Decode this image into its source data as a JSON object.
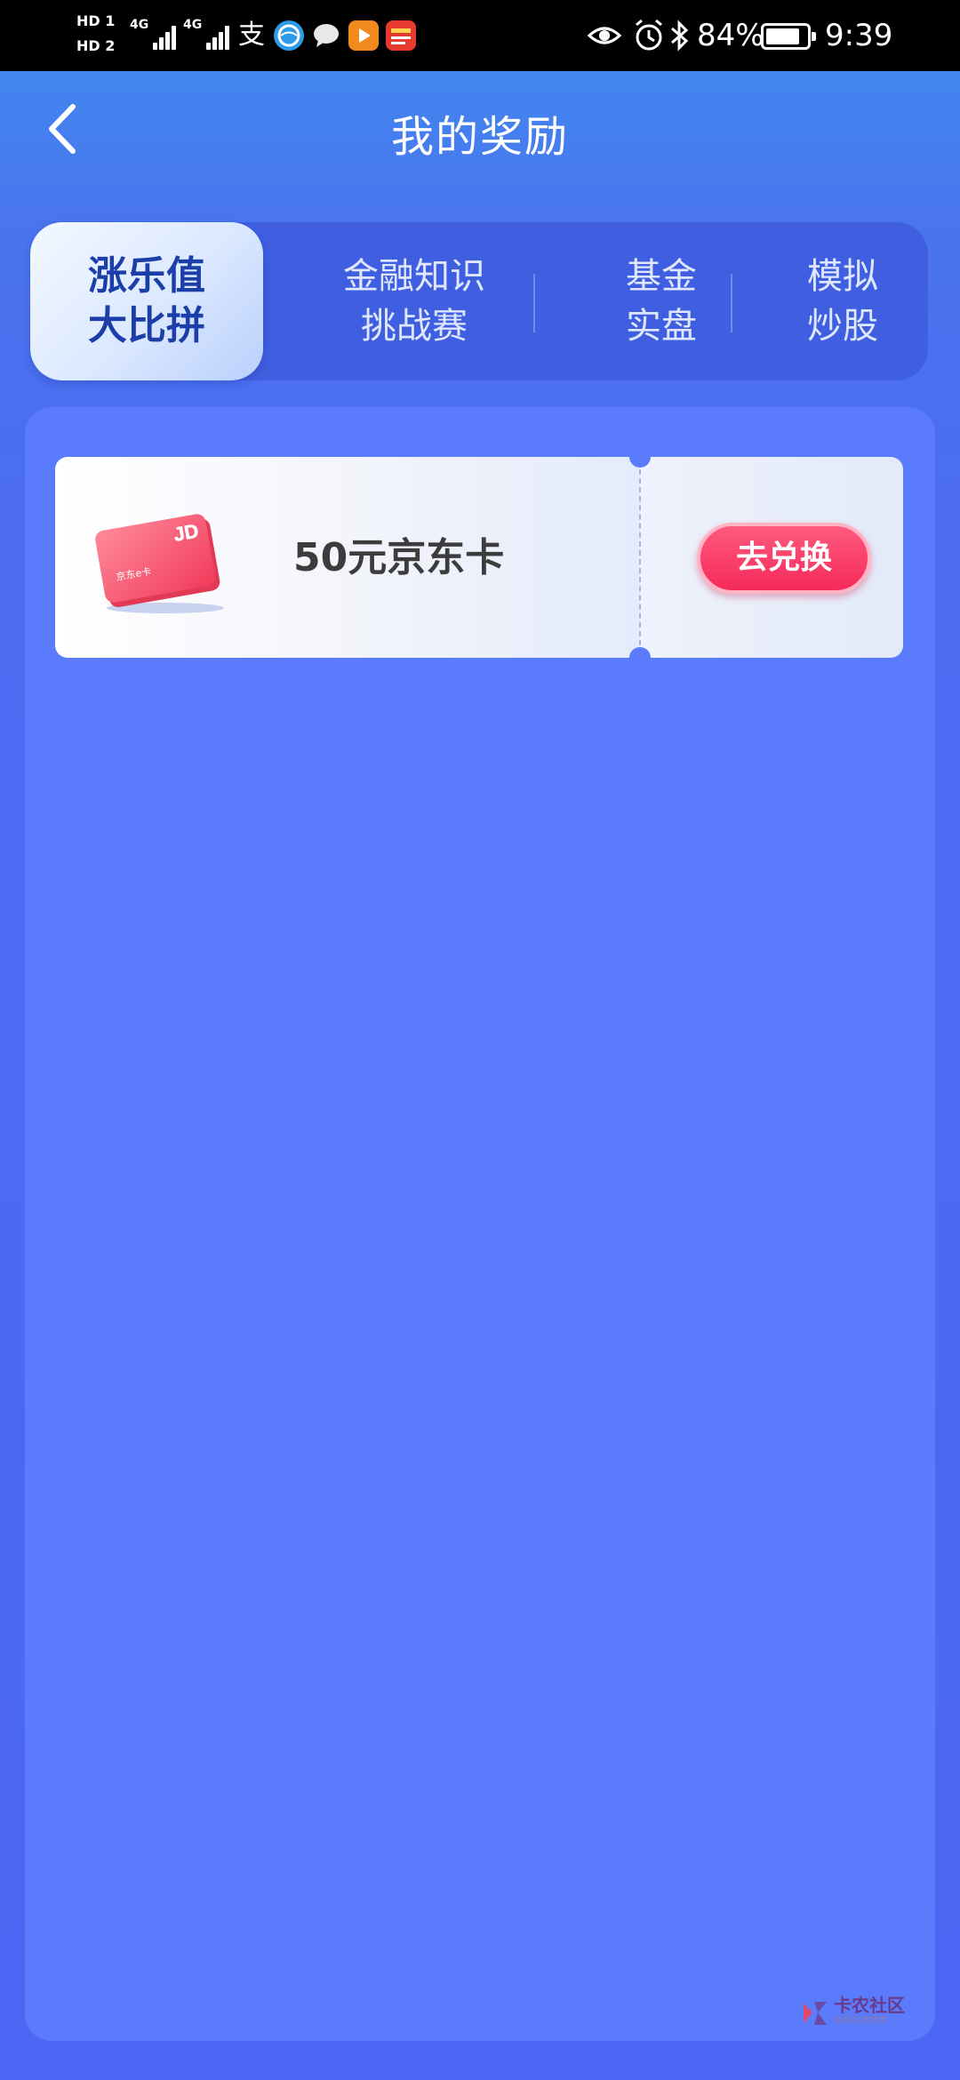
{
  "status_bar": {
    "hd1": "HD 1",
    "hd2": "HD 2",
    "net1": "4G",
    "net2": "4G",
    "alipay_glyph": "支",
    "battery_percent": "84%",
    "battery_level": 0.84,
    "time": "9:39",
    "icons": [
      "eye-icon",
      "alarm-icon",
      "bluetooth-icon",
      "battery-icon"
    ],
    "app_icons": [
      "alipay-icon",
      "browser-icon",
      "message-icon",
      "video-icon",
      "news-icon"
    ]
  },
  "header": {
    "title": "我的奖励",
    "back_icon": "chevron-left-icon"
  },
  "tabs": [
    {
      "line1": "涨乐值",
      "line2": "大比拼",
      "active": true
    },
    {
      "line1": "金融知识",
      "line2": "挑战赛",
      "active": false
    },
    {
      "line1": "基金",
      "line2": "实盘",
      "active": false
    },
    {
      "line1": "模拟",
      "line2": "炒股",
      "active": false
    }
  ],
  "rewards": [
    {
      "card_brand": "JD",
      "card_label": "京东e卡",
      "name": "50元京东卡",
      "action": "去兑换"
    }
  ],
  "watermark": {
    "text": "卡农社区",
    "sub": "金融在线教育"
  },
  "colors": {
    "accent_red": "#f52a5a",
    "panel_blue": "#5b7bfd",
    "active_tab_text": "#1b3ea8"
  }
}
